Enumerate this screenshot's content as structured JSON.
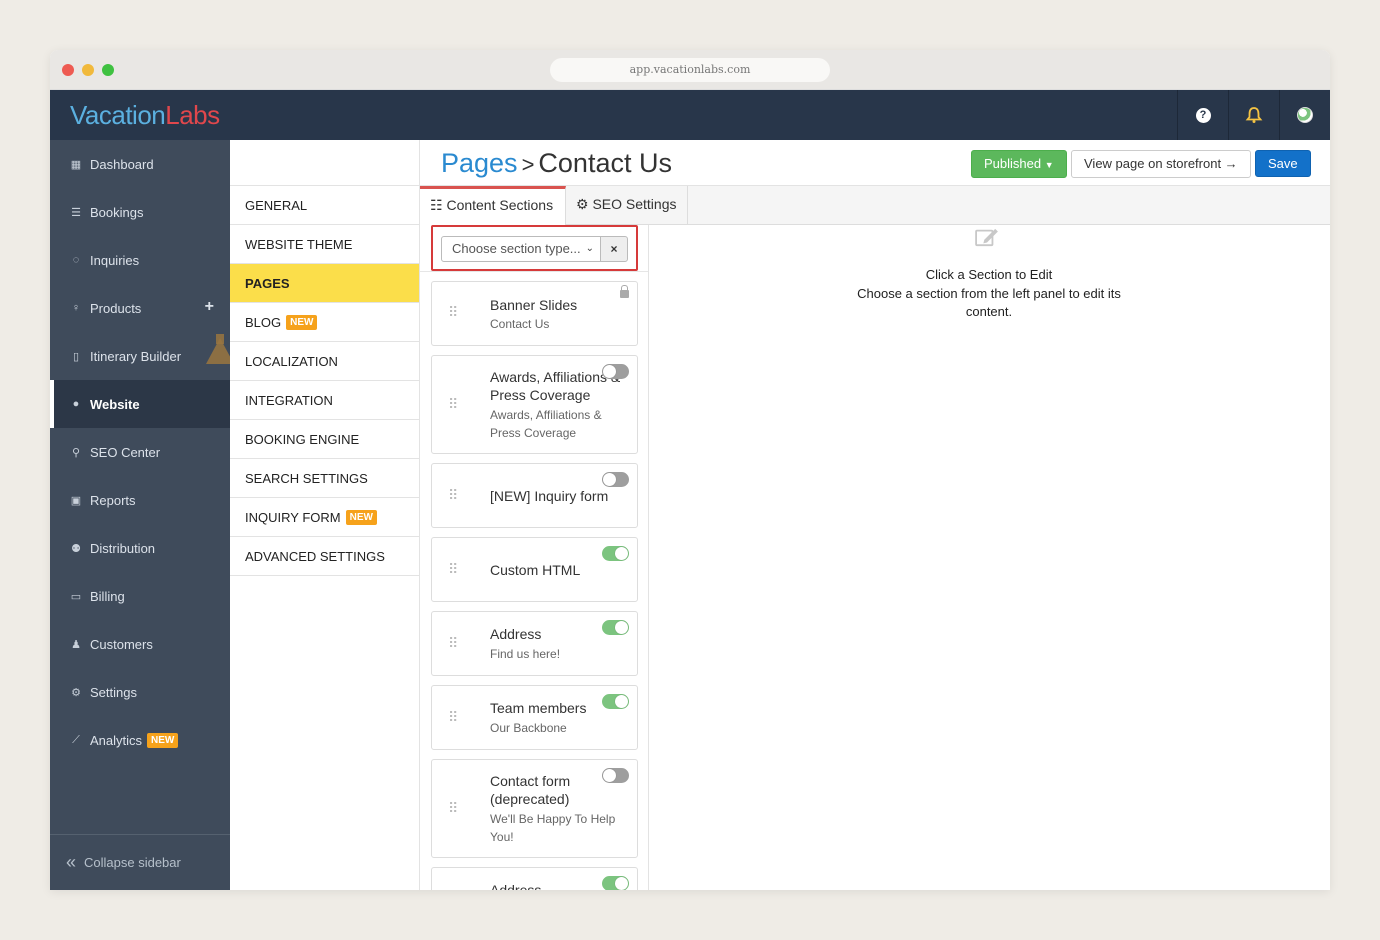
{
  "browser": {
    "url": "app.vacationlabs.com"
  },
  "brand": {
    "logo_part1": "Vacation",
    "logo_part2": "Labs"
  },
  "topbar": {
    "help_icon": "?",
    "bell_icon": "bell",
    "avatar_icon": "globe"
  },
  "sidebar": {
    "items": [
      {
        "label": "Dashboard",
        "icon": "calendar-icon"
      },
      {
        "label": "Bookings",
        "icon": "list-icon"
      },
      {
        "label": "Inquiries",
        "icon": "chat-icon"
      },
      {
        "label": "Products",
        "icon": "lightbulb-icon"
      },
      {
        "label": "Itinerary Builder",
        "icon": "map-icon"
      },
      {
        "label": "Website",
        "icon": "globe-icon"
      },
      {
        "label": "SEO Center",
        "icon": "search-icon"
      },
      {
        "label": "Reports",
        "icon": "file-excel-icon"
      },
      {
        "label": "Distribution",
        "icon": "users-icon"
      },
      {
        "label": "Billing",
        "icon": "money-icon"
      },
      {
        "label": "Customers",
        "icon": "user-icon"
      },
      {
        "label": "Settings",
        "icon": "gear-icon"
      },
      {
        "label": "Analytics",
        "icon": "line-chart-icon",
        "badge": "NEW"
      }
    ],
    "collapse_label": "Collapse sidebar"
  },
  "subnav": {
    "items": [
      {
        "label": "GENERAL"
      },
      {
        "label": "WEBSITE THEME"
      },
      {
        "label": "PAGES"
      },
      {
        "label": "BLOG",
        "badge": "NEW"
      },
      {
        "label": "LOCALIZATION"
      },
      {
        "label": "INTEGRATION"
      },
      {
        "label": "BOOKING ENGINE"
      },
      {
        "label": "SEARCH SETTINGS"
      },
      {
        "label": "INQUIRY FORM",
        "badge": "NEW"
      },
      {
        "label": "ADVANCED SETTINGS"
      }
    ]
  },
  "header": {
    "breadcrumb_link": "Pages",
    "breadcrumb_sep": ">",
    "page_title": "Contact Us",
    "published_label": "Published",
    "view_label": "View page on storefront →",
    "save_label": "Save"
  },
  "tabs": {
    "content_label": "Content Sections",
    "seo_label": "SEO Settings"
  },
  "section_chooser": {
    "placeholder": "Choose section type...",
    "clear": "×"
  },
  "sections": [
    {
      "title": "Banner Slides",
      "subtitle": "Contact Us",
      "state": "locked"
    },
    {
      "title": "Awards, Affiliations & Press Coverage",
      "subtitle": "Awards, Affiliations & Press Coverage",
      "state": "off"
    },
    {
      "title": "[NEW] Inquiry form",
      "subtitle": "",
      "state": "off"
    },
    {
      "title": "Custom HTML",
      "subtitle": "",
      "state": "on"
    },
    {
      "title": "Address",
      "subtitle": "Find us here!",
      "state": "on"
    },
    {
      "title": "Team members",
      "subtitle": "Our Backbone",
      "state": "on"
    },
    {
      "title": "Contact form (deprecated)",
      "subtitle": "We'll Be Happy To Help You!",
      "state": "off"
    },
    {
      "title": "Address",
      "subtitle": "",
      "state": "on"
    }
  ],
  "editor": {
    "empty_title": "Click a Section to Edit",
    "empty_desc": "Choose a section from the left panel to edit its content."
  }
}
